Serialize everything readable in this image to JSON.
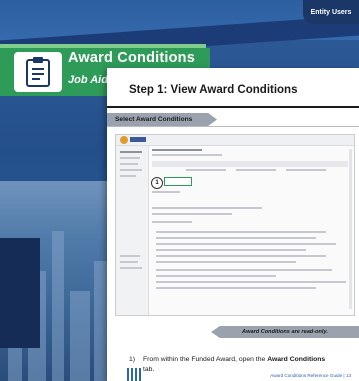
{
  "cover": {
    "badge": "Entity Users",
    "title": "Award Conditions",
    "subtitle": "Job Aid"
  },
  "page": {
    "heading": "Step 1: View Award Conditions",
    "section_tab": "Select Award Conditions",
    "callout_number": "1",
    "note_banner": "Award Conditions are read-only.",
    "step": {
      "number": "1)",
      "text_before": "From within the Funded Award, open the ",
      "text_bold": "Award Conditions",
      "text_after": " tab."
    },
    "footer": "Award Conditions Reference Guide | 13"
  },
  "colors": {
    "accent_green": "#2e9b58",
    "navy": "#1b3767",
    "footer_blue": "#2d63b0"
  }
}
